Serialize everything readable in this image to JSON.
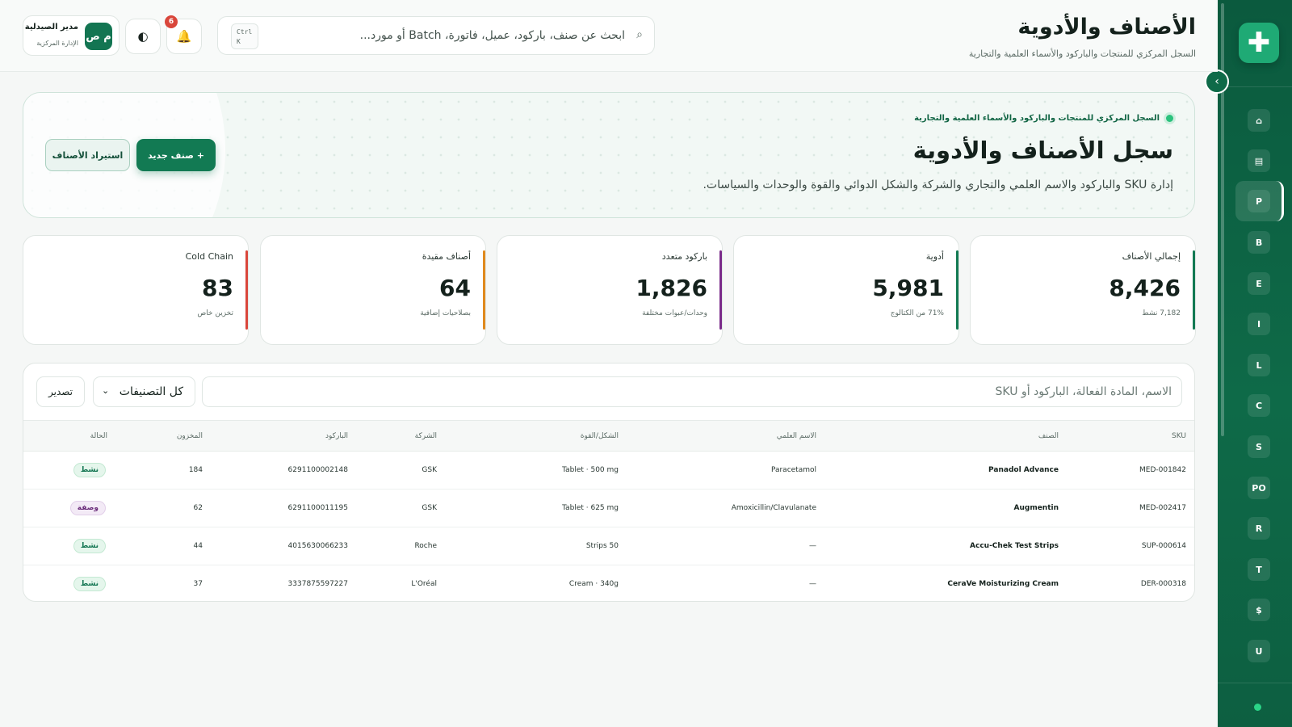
{
  "header": {
    "title": "الأصناف والأدوية",
    "subtitle": "السجل المركزي للمنتجات والباركود والأسماء العلمية والتجارية"
  },
  "search": {
    "placeholder": "ابحث عن صنف، باركود، عميل، فاتورة، Batch أو مورد...",
    "kbd_line1": "Ctrl",
    "kbd_line2": "K"
  },
  "notifications": {
    "count": "6"
  },
  "user": {
    "initials": "م ص",
    "name": "مدير الصيدلية",
    "role": "الإدارة المركزية"
  },
  "hero": {
    "eyebrow": "السجل المركزي للمنتجات والباركود والأسماء العلمية والتجارية",
    "title": "سجل الأصناف والأدوية",
    "description": "إدارة SKU والباركود والاسم العلمي والتجاري والشركة والشكل الدوائي والقوة والوحدات والسياسات.",
    "new_item_label": "+  صنف جديد",
    "import_label": "استيراد الأصناف"
  },
  "stats": [
    {
      "label": "إجمالي الأصناف",
      "value": "8,426",
      "note": "7,182 نشط",
      "color": "#127a53"
    },
    {
      "label": "أدوية",
      "value": "5,981",
      "note": "71% من الكتالوج",
      "color": "#127a53"
    },
    {
      "label": "باركود متعدد",
      "value": "1,826",
      "note": "وحدات/عبوات مختلفة",
      "color": "#7a2b8a"
    },
    {
      "label": "أصناف مقيدة",
      "value": "64",
      "note": "بصلاحيات إضافية",
      "color": "#e08a1e"
    },
    {
      "label": "Cold Chain",
      "value": "83",
      "note": "تخزين خاص",
      "color": "#d9463b"
    }
  ],
  "table": {
    "filter_placeholder": "الاسم، المادة الفعالة، الباركود أو SKU",
    "category_select": "كل التصنيفات",
    "export_label": "تصدير",
    "columns": {
      "sku": "SKU",
      "name": "الصنف",
      "scientific": "الاسم العلمي",
      "form": "الشكل/القوة",
      "company": "الشركة",
      "barcode": "الباركود",
      "stock": "المخزون",
      "status": "الحالة"
    },
    "rows": [
      {
        "sku": "MED-001842",
        "name": "Panadol Advance",
        "scientific": "Paracetamol",
        "form": "Tablet · 500 mg",
        "company": "GSK",
        "barcode": "6291100002148",
        "stock": "184",
        "status": "نشط"
      },
      {
        "sku": "MED-002417",
        "name": "Augmentin",
        "scientific": "Amoxicillin/Clavulanate",
        "form": "Tablet · 625 mg",
        "company": "GSK",
        "barcode": "6291100011195",
        "stock": "62",
        "status": "وصفة"
      },
      {
        "sku": "SUP-000614",
        "name": "Accu-Chek Test Strips",
        "scientific": "—",
        "form": "Strips 50",
        "company": "Roche",
        "barcode": "4015630066233",
        "stock": "44",
        "status": "نشط"
      },
      {
        "sku": "DER-000318",
        "name": "CeraVe Moisturizing Cream",
        "scientific": "—",
        "form": "Cream · 340g",
        "company": "L'Oréal",
        "barcode": "3337875597227",
        "stock": "37",
        "status": "نشط"
      }
    ]
  },
  "sidebar": {
    "logo_icon": "plus-cross-icon",
    "items": [
      "⌂",
      "▤",
      "P",
      "B",
      "E",
      "I",
      "L",
      "C",
      "S",
      "PO",
      "R",
      "T",
      "$",
      "U"
    ],
    "active_index": 2
  }
}
